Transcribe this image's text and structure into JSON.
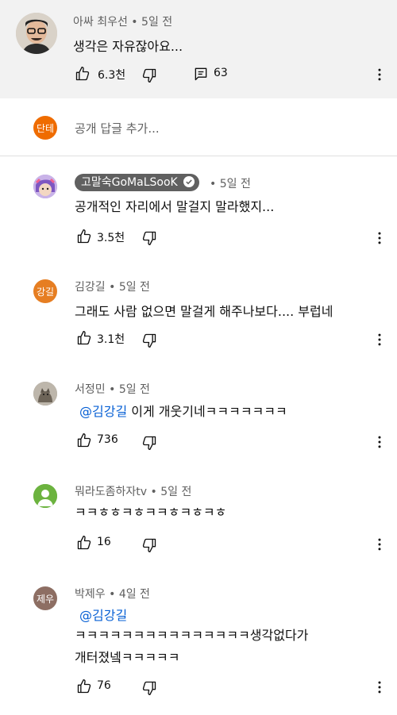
{
  "colors": {
    "reply_avatar": "#ef6c00",
    "kim_avatar": "#e67e22",
    "park_avatar": "#8d6e63",
    "default_avatar": "#6cb33f",
    "mention": "#065fd4"
  },
  "top_comment": {
    "author": "아싸 최우선",
    "time": "5일 전",
    "text": "생각은 자유잖아요...",
    "likes": "6.3천",
    "replies": "63"
  },
  "reply_box": {
    "avatar_letter": "단테",
    "placeholder": "공개 답글 추가..."
  },
  "replies": [
    {
      "author": "고말숙GoMaLSooK",
      "time": "5일 전",
      "text": "공개적인 자리에서 말걸지 말라했지...",
      "likes": "3.5천"
    },
    {
      "author": "김강길",
      "avatar_letter": "강길",
      "time": "5일 전",
      "text": "그래도 사람 없으면 말걸게 해주나보다.... 부럽네",
      "likes": "3.1천"
    },
    {
      "author": "서정민",
      "time": "5일 전",
      "mention": "@김강길",
      "text": " 이게 개웃기네ㅋㅋㅋㅋㅋㅋㅋ",
      "likes": "736"
    },
    {
      "author": "뭐라도좀하자tv",
      "time": "5일 전",
      "text": "ㅋㅋㅎㅎㅋㅎㅋㅋㅎㅋㅎㅋㅎ",
      "likes": "16"
    },
    {
      "author": "박제우",
      "avatar_letter": "제우",
      "time": "4일 전",
      "mention": "@김강길",
      "line1": "ㅋㅋㅋㅋㅋㅋㅋㅋㅋㅋㅋㅋㅋㅋㅋ생각없다가",
      "line2": "개터졌넼ㅋㅋㅋㅋㅋ",
      "likes": "76"
    }
  ]
}
